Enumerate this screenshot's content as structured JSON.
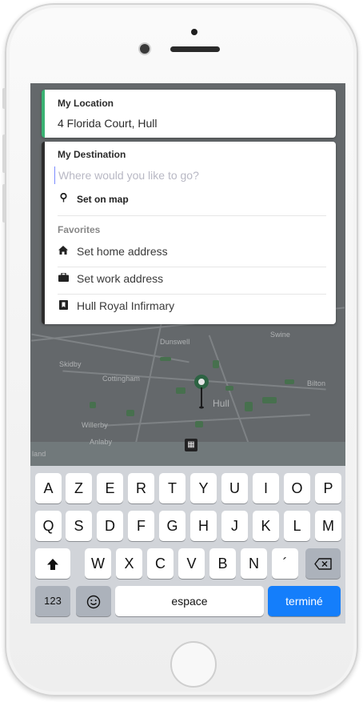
{
  "location": {
    "title": "My Location",
    "value": "4 Florida Court, Hull"
  },
  "destination": {
    "title": "My Destination",
    "placeholder": "Where would you like to go?",
    "set_on_map": "Set on map",
    "favorites_label": "Favorites",
    "favorites": [
      {
        "label": "Set home address",
        "icon": "home-icon"
      },
      {
        "label": "Set work address",
        "icon": "briefcase-icon"
      },
      {
        "label": "Hull Royal Infirmary",
        "icon": "bookmark-icon"
      }
    ]
  },
  "map_labels": {
    "swine": "Swine",
    "dunswell": "Dunswell",
    "skidby": "Skidby",
    "cottingham": "Cottingham",
    "bilton": "Bilton",
    "hull": "Hull",
    "willerby": "Willerby",
    "anlaby": "Anlaby",
    "land": "land"
  },
  "keyboard": {
    "row1": [
      "A",
      "Z",
      "E",
      "R",
      "T",
      "Y",
      "U",
      "I",
      "O",
      "P"
    ],
    "row2": [
      "Q",
      "S",
      "D",
      "F",
      "G",
      "H",
      "J",
      "K",
      "L",
      "M"
    ],
    "row3": [
      "W",
      "X",
      "C",
      "V",
      "B",
      "N",
      "´"
    ],
    "numbers": "123",
    "space": "espace",
    "done": "terminé"
  },
  "colors": {
    "location_accent": "#3bb273",
    "done_key": "#147efb"
  }
}
